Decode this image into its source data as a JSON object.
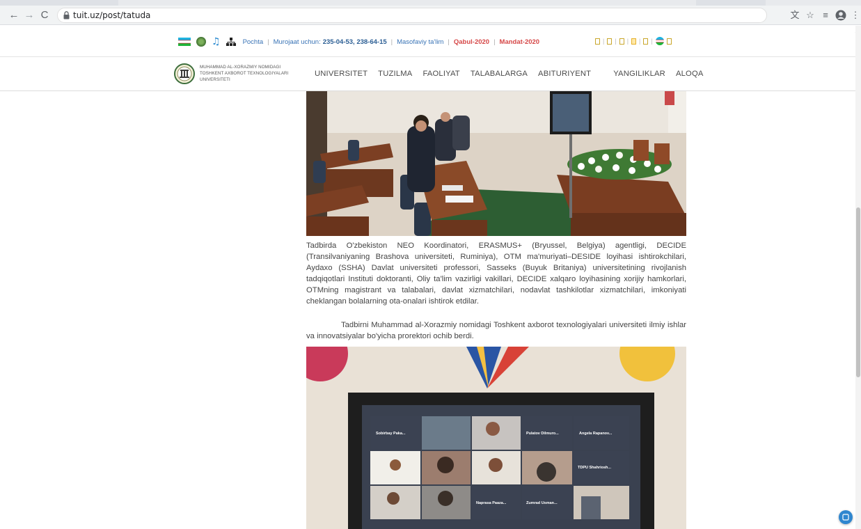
{
  "browser": {
    "url": "tuit.uz/post/tatuda",
    "icons": [
      "back-icon",
      "forward-icon",
      "reload-icon",
      "lock-icon",
      "translate-icon",
      "star-icon",
      "reading-list-icon",
      "profile-icon",
      "menu-icon"
    ]
  },
  "topbar": {
    "pochta": "Pochta",
    "murojaat_label": "Murojaat uchun:",
    "phones": "235-04-53, 238-64-15",
    "masofaviy": "Masofaviy ta'lim",
    "qabul": "Qabul-2020",
    "mandat": "Mandat-2020",
    "colors": {
      "link": "#3a74b6",
      "accent_red": "#d64848"
    }
  },
  "logo": {
    "line1": "MUHAMMAD AL-XORAZMIY NOMIDAGI",
    "line2": "TOSHKENT AXBOROT TEXNOLOGIYALARI",
    "line3": "UNIVERSITETI"
  },
  "nav": {
    "items": [
      {
        "label": "UNIVERSITET",
        "caret": ""
      },
      {
        "label": "TUZILMA",
        "caret": ""
      },
      {
        "label": "FAOLIYAT",
        "caret": ""
      },
      {
        "label": "TALABALARGA",
        "caret": ""
      },
      {
        "label": "ABITURIYENT",
        "caret": ""
      },
      {
        "label": "YANGILIKLAR",
        "caret": ""
      },
      {
        "label": "ALOQA",
        "caret": ""
      }
    ]
  },
  "article": {
    "paragraph1": "Tadbirda O'zbekiston NEO Koordinatori, ERASMUS+ (Bryussel, Belgiya) agentligi, DECIDE (Transilvaniyaning Brashova universiteti, Ruminiya), OTM ma'muriyati–DESIDE loyihasi ishtirokchilari, Aydaxo (SSHA) Davlat universiteti professori, Sasseks (Buyuk Britaniya) universitetining rivojlanish tadqiqotlari Instituti doktoranti, Oliy ta'lim vazirligi vakillari, DECIDE xalqaro loyihasining xorijiy hamkorlari, OTMning magistrant va talabalari, davlat xizmatchilari, nodavlat tashkilotlar xizmatchilari, imkoniyati cheklangan bolalarning ota-onalari ishtirok etdilar.",
    "paragraph2": "Tadbirni Muhammad al-Xorazmiy nomidagi Toshkent axborot texnologiyalari universiteti ilmiy ishlar va innovatsiyalar bo'yicha prorektori ochib berdi."
  },
  "photo2": {
    "tiles": [
      "Sobirbay Paka...",
      "Pulatov Dilmuro...",
      "Angela Rapanov...",
      "TDPU Shahriosh...",
      "Naprasa Paaza...",
      "Zumrad Usman..."
    ]
  }
}
